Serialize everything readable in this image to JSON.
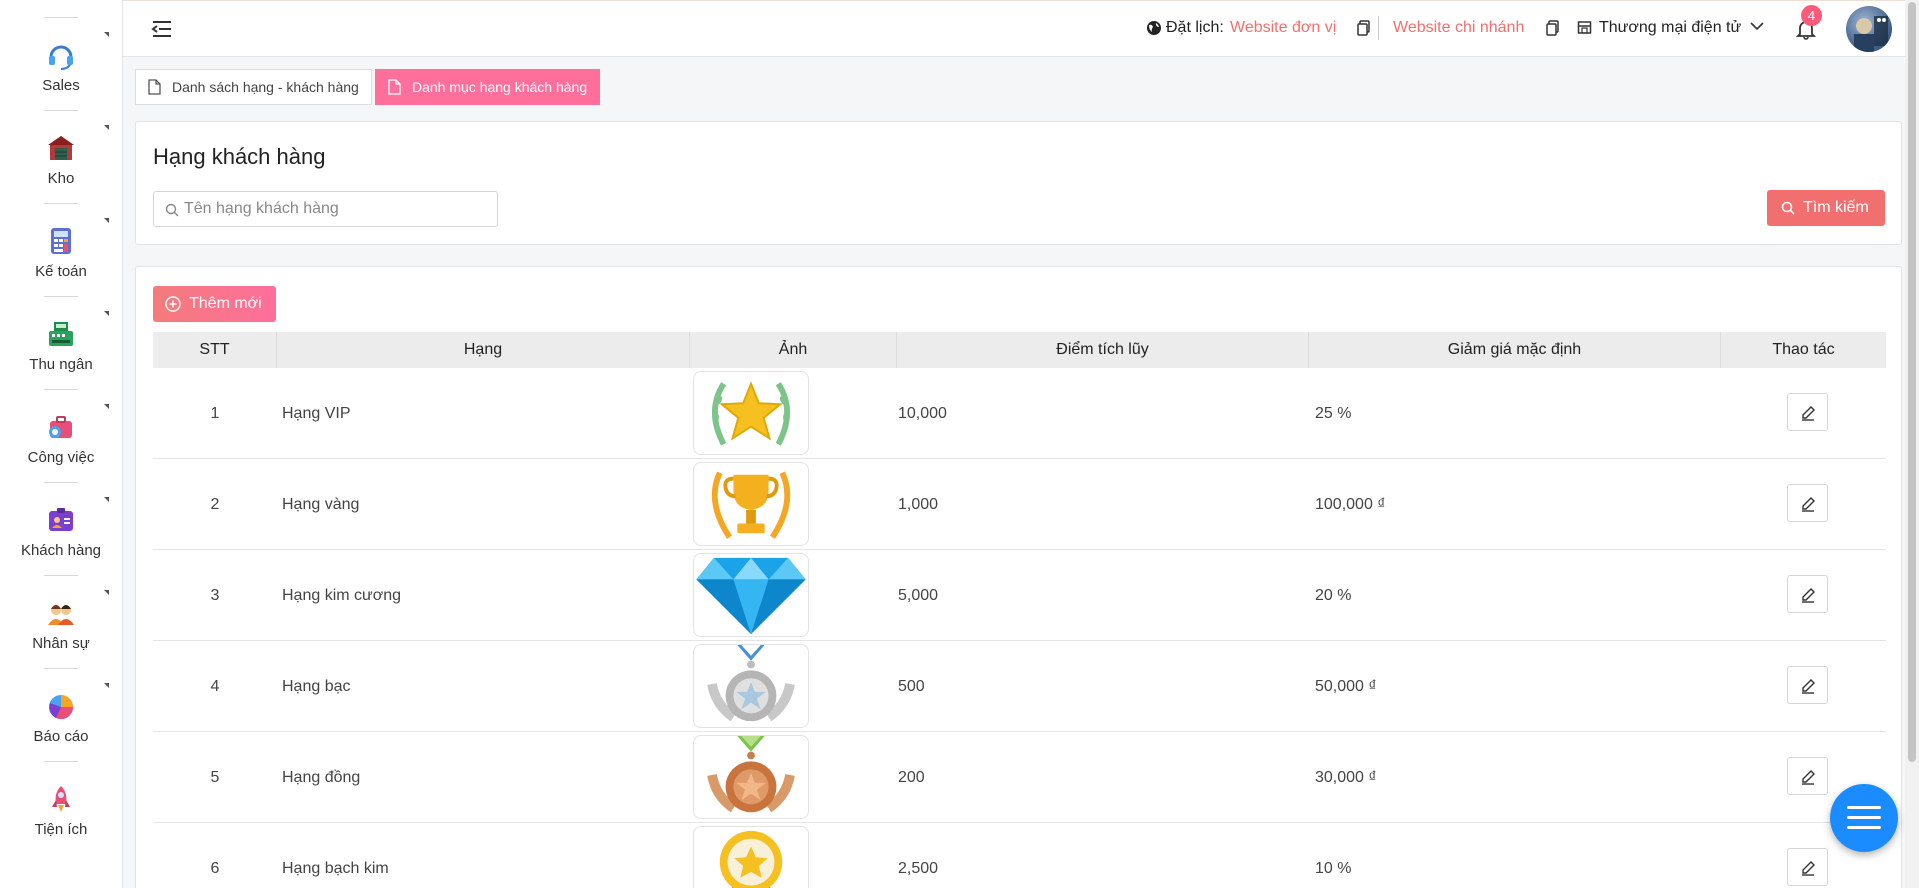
{
  "sidebar": {
    "items": [
      {
        "label": "Sales",
        "icon": "headset-icon"
      },
      {
        "label": "Kho",
        "icon": "warehouse-icon"
      },
      {
        "label": "Kế toán",
        "icon": "calculator-icon"
      },
      {
        "label": "Thu ngân",
        "icon": "cash-register-icon"
      },
      {
        "label": "Công việc",
        "icon": "briefcase-icon"
      },
      {
        "label": "Khách hàng",
        "icon": "customer-card-icon"
      },
      {
        "label": "Nhân sự",
        "icon": "people-icon"
      },
      {
        "label": "Báo cáo",
        "icon": "pie-chart-icon"
      },
      {
        "label": "Tiện ích",
        "icon": "rocket-icon"
      }
    ]
  },
  "topbar": {
    "booking_label": "Đặt lịch:",
    "website_unit": "Website đơn vị",
    "website_branch": "Website chi nhánh",
    "store_label": "Thương mại điện tử",
    "notification_count": "4"
  },
  "tabs": [
    {
      "label": "Danh sách hạng - khách hàng",
      "active": false
    },
    {
      "label": "Danh mục hạng khách hàng",
      "active": true
    }
  ],
  "search": {
    "title": "Hạng khách hàng",
    "placeholder": "Tên hạng khách hàng",
    "button": "Tìm kiếm"
  },
  "list": {
    "add_button": "Thêm mới",
    "columns": [
      "STT",
      "Hạng",
      "Ảnh",
      "Điểm tích lũy",
      "Giảm giá mặc định",
      "Thao tác"
    ],
    "rows": [
      {
        "stt": "1",
        "name": "Hạng VIP",
        "image": "star-laurel",
        "points": "10,000",
        "discount": "25 %"
      },
      {
        "stt": "2",
        "name": "Hạng vàng",
        "image": "gold-trophy",
        "points": "1,000",
        "discount": "100,000 ₫"
      },
      {
        "stt": "3",
        "name": "Hạng kim cương",
        "image": "diamond",
        "points": "5,000",
        "discount": "20 %"
      },
      {
        "stt": "4",
        "name": "Hạng bạc",
        "image": "silver-medal",
        "points": "500",
        "discount": "50,000 ₫"
      },
      {
        "stt": "5",
        "name": "Hạng đồng",
        "image": "bronze-medal",
        "points": "200",
        "discount": "30,000 ₫"
      },
      {
        "stt": "6",
        "name": "Hạng bạch kim",
        "image": "platinum-badge",
        "points": "2,500",
        "discount": "10 %"
      }
    ]
  },
  "colors": {
    "accent_red": "#f26f6f",
    "accent_pink": "#ff6f9c",
    "fab_blue": "#1a8cff"
  }
}
